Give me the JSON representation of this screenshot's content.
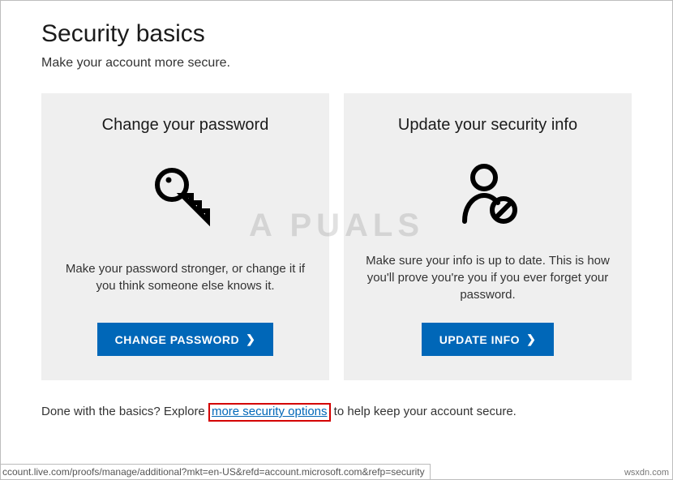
{
  "page": {
    "title": "Security basics",
    "subtitle": "Make your account more secure."
  },
  "cards": {
    "password": {
      "title": "Change your password",
      "text": "Make your password stronger, or change it if you think someone else knows it.",
      "button": "CHANGE PASSWORD"
    },
    "info": {
      "title": "Update your security info",
      "text": "Make sure your info is up to date. This is how you'll prove you're you if you ever forget your password.",
      "button": "UPDATE INFO"
    }
  },
  "footer": {
    "prefix": "Done with the basics? Explore ",
    "link": "more security options",
    "suffix": " to help keep your account secure."
  },
  "statusbar": "ccount.live.com/proofs/manage/additional?mkt=en-US&refd=account.microsoft.com&refp=security",
  "watermark": "A   PUALS",
  "attribution": "wsxdn.com",
  "colors": {
    "accent": "#0067b8",
    "highlight": "#d40000",
    "card_bg": "#efefef"
  }
}
